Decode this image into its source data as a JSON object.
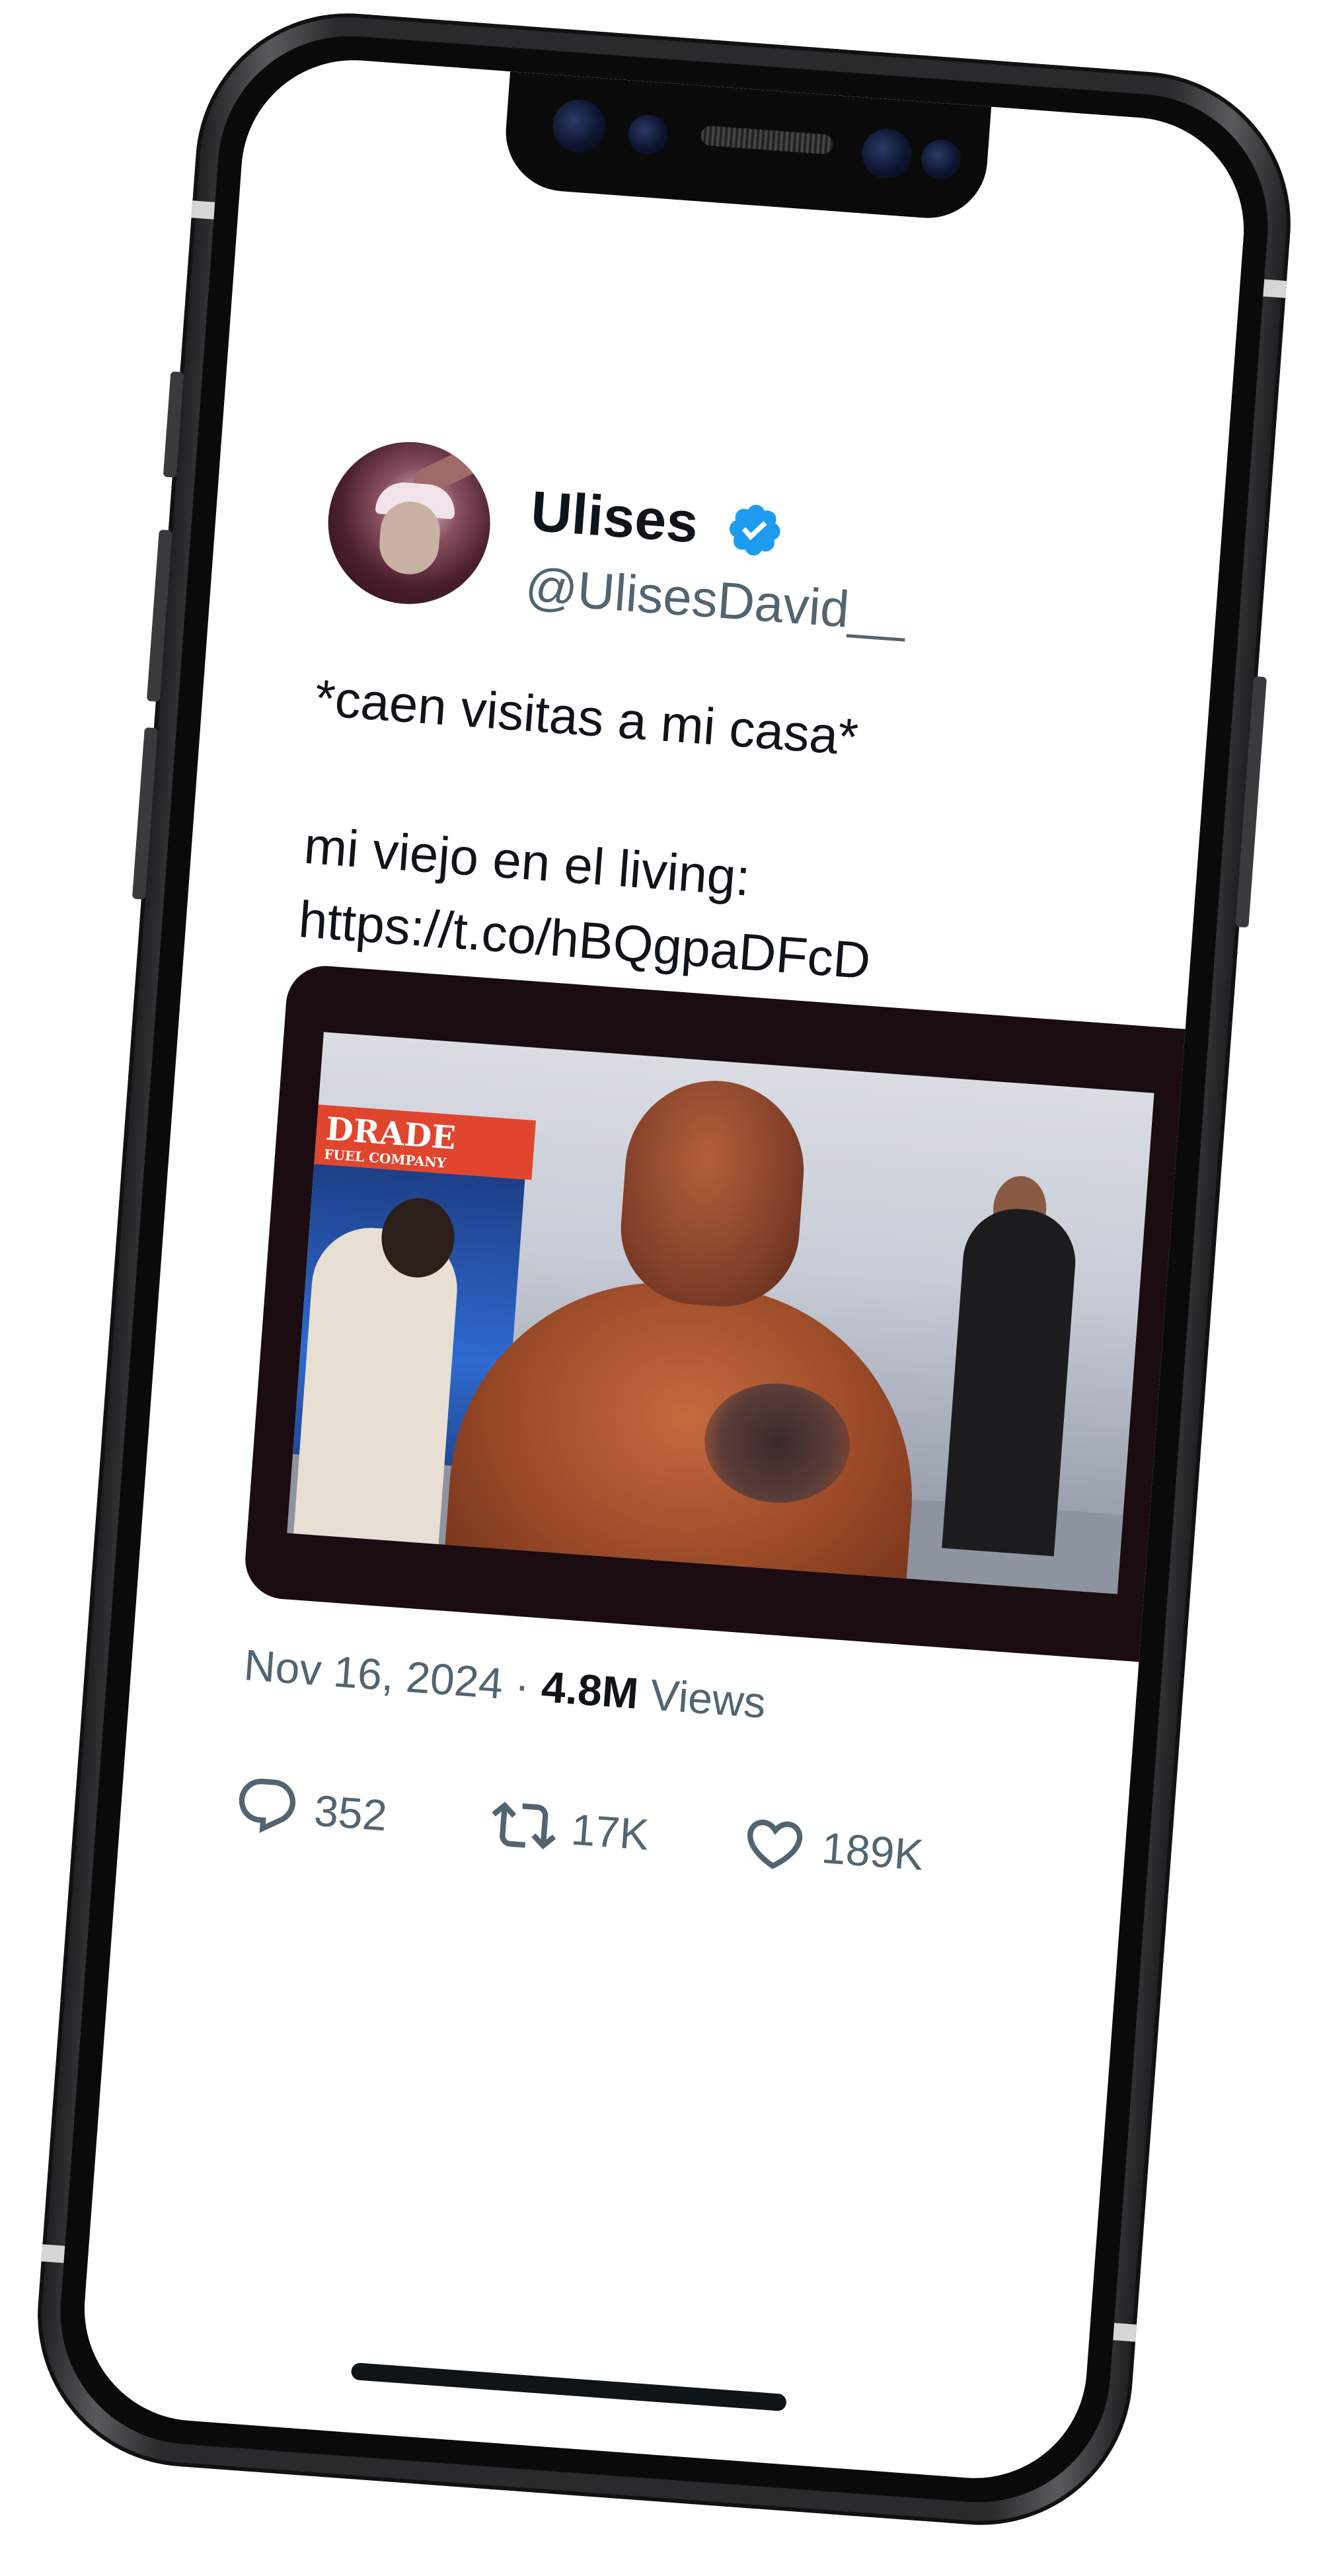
{
  "tweet": {
    "display_name": "Ulises",
    "handle": "@UlisesDavid__",
    "verified": true,
    "body": "*caen visitas a mi casa*\n\nmi viejo en el living:\nhttps://t.co/hBQgpaDFcD",
    "date": "Nov 16, 2024",
    "separator": "·",
    "views_count": "4.8M",
    "views_label": "Views",
    "actions": {
      "replies": "352",
      "reposts": "17K",
      "likes": "189K"
    },
    "media": {
      "sign_text": "DRADE",
      "sign_subtext": "FUEL COMPANY"
    }
  },
  "icons": {
    "verified": "verified-badge-icon",
    "brand": "x-logo-icon",
    "reply": "reply-icon",
    "repost": "repost-icon",
    "like": "heart-icon"
  },
  "colors": {
    "text_primary": "#0f1419",
    "text_secondary": "#536471",
    "verified_blue": "#1d9bf0",
    "background": "#ffffff"
  }
}
